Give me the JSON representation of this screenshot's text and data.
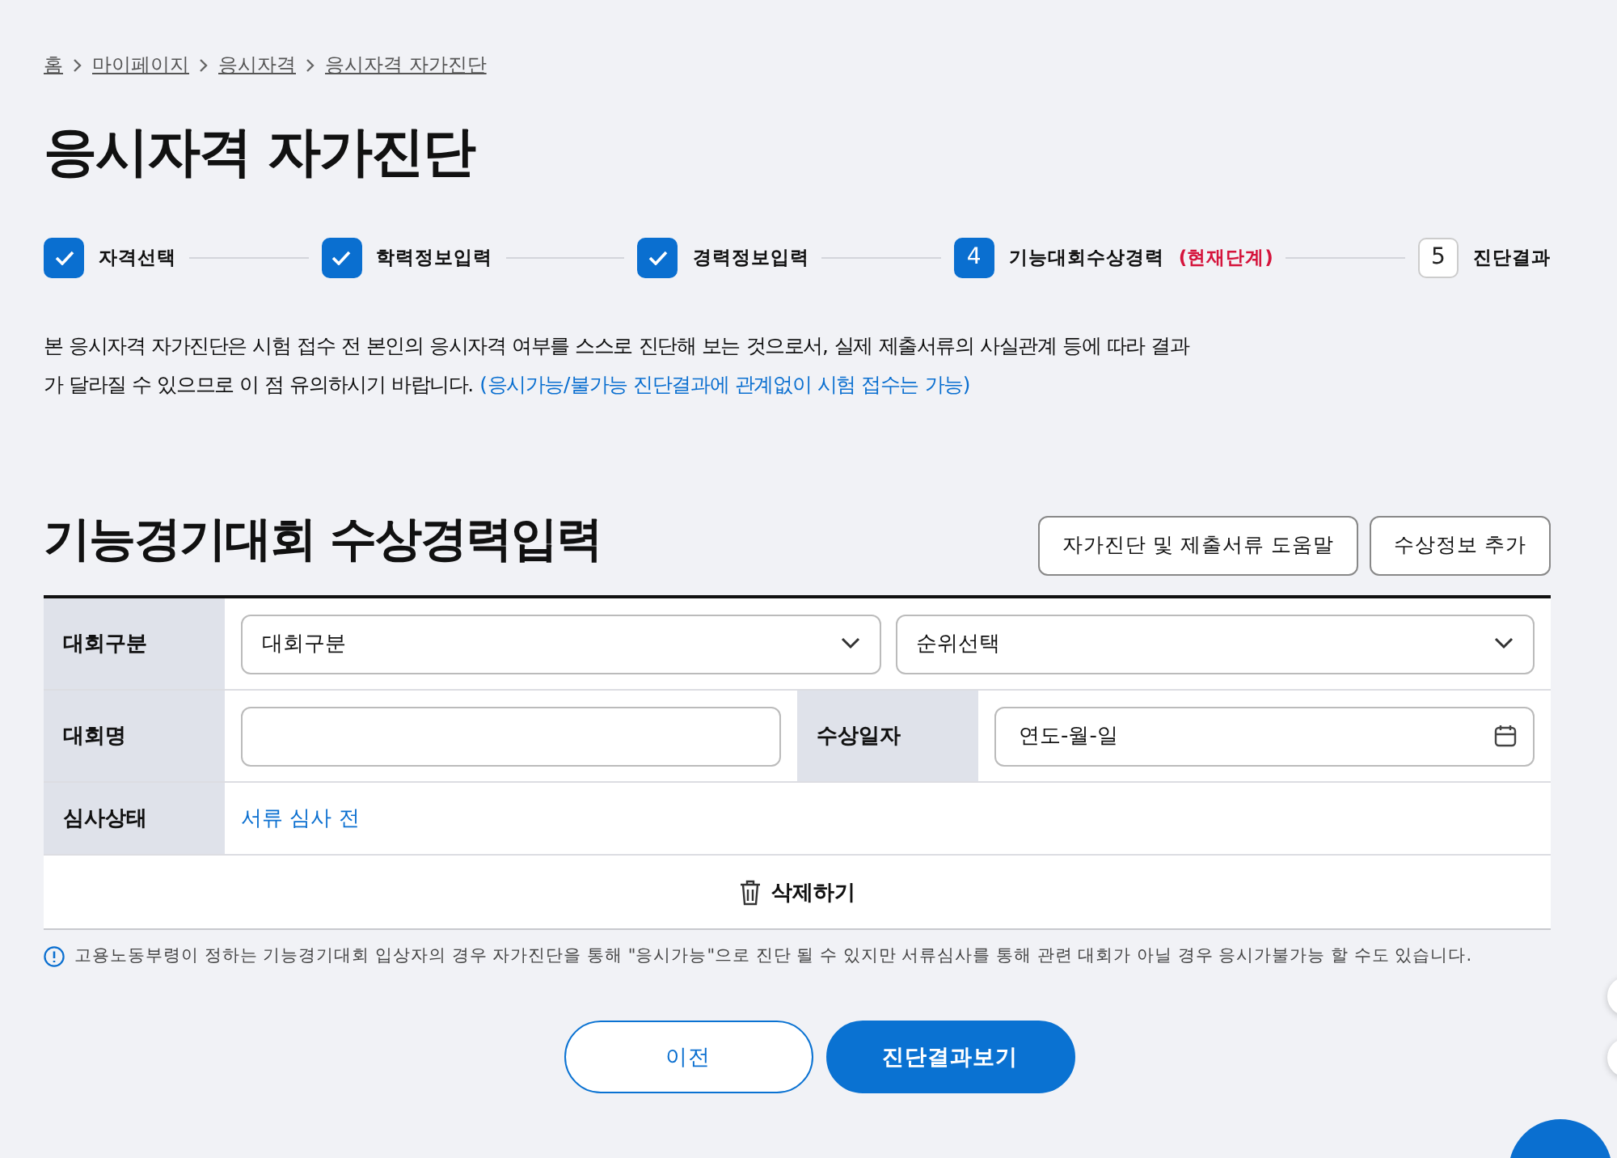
{
  "breadcrumb": [
    {
      "label": "홈"
    },
    {
      "label": "마이페이지"
    },
    {
      "label": "응시자격"
    },
    {
      "label": "응시자격 자가진단"
    }
  ],
  "page_title": "응시자격 자가진단",
  "steps": [
    {
      "kind": "done",
      "label": "자격선택"
    },
    {
      "kind": "done",
      "label": "학력정보입력"
    },
    {
      "kind": "done",
      "label": "경력정보입력"
    },
    {
      "kind": "current",
      "marker": "4",
      "label": "기능대회수상경력",
      "note": "(현재단계)"
    },
    {
      "kind": "pending",
      "marker": "5",
      "label": "진단결과"
    }
  ],
  "intro": {
    "text": "본 응시자격 자가진단은 시험 접수 전 본인의 응시자격 여부를 스스로 진단해 보는 것으로서, 실제 제출서류의 사실관계 등에 따라 결과가 달라질 수 있으므로 이 점 유의하시기 바랍니다.",
    "highlight": "(응시가능/불가능 진단결과에 관계없이 시험 접수는 가능)"
  },
  "section": {
    "title": "기능경기대회 수상경력입력",
    "buttons": [
      "자가진단 및 제출서류 도움말",
      "수상정보 추가"
    ]
  },
  "form": {
    "category_label": "대회구분",
    "category_select": "대회구분",
    "rank_select": "순위선택",
    "name_label": "대회명",
    "date_label": "수상일자",
    "date_placeholder": "연도-월-일",
    "status_label": "심사상태",
    "status_value": "서류 심사 전",
    "delete_button": "삭제하기"
  },
  "notice": "고용노동부령이 정하는 기능경기대회 입상자의 경우 자가진단을 통해 \"응시가능\"으로 진단 될 수 있지만 서류심사를 통해 관련 대회가 아닐 경우 응시가불가능 할 수도 있습니다.",
  "nav_buttons": [
    {
      "label": "이전",
      "kind": "secondary"
    },
    {
      "label": "진단결과보기",
      "kind": "primary"
    }
  ]
}
